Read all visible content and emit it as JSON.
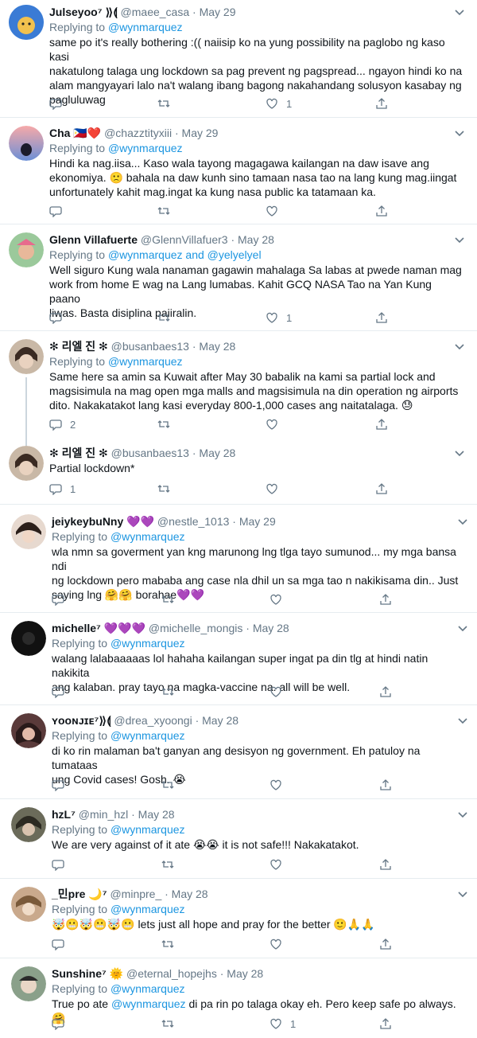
{
  "reply_prefix": "Replying to",
  "tweets": [
    {
      "name": "Julseyoo⁷ ⟫⟬",
      "meta": "@maee_casa · May 29",
      "reply_to": "@wynmarquez",
      "lines": [
        "same po it's really bothering :(( naiisip ko na yung possibility na paglobo ng kaso kasi",
        "nakatulong talaga ung lockdown sa pag prevent ng pagspread... ngayon hindi ko na",
        "alam mangyayari lalo na't walang ibang bagong nakahandang solusyon kasabay ng",
        "pagluluwag"
      ],
      "reply_count": "",
      "like_count": "1"
    },
    {
      "name": "Cha 🇵🇭❤️",
      "meta": "@chazztityxiii · May 29",
      "reply_to": "@wynmarquez",
      "lines": [
        "Hindi ka nag.iisa... Kaso wala tayong magagawa kailangan na daw isave ang",
        "ekonomiya. 🙁 bahala na daw kunh sino tamaan nasa tao na lang kung mag.iingat",
        "unfortunately kahit mag.ingat ka kung nasa public ka tatamaan ka."
      ],
      "reply_count": "",
      "like_count": ""
    },
    {
      "name": "Glenn Villafuerte",
      "meta": "@GlennVillafuer3 · May 28",
      "reply_to": "@wynmarquez and @yelyelyel",
      "lines": [
        "Well siguro Kung wala nanaman gagawin mahalaga Sa labas at pwede naman mag",
        "work from home E wag na Lang lumabas. Kahit GCQ NASA Tao na Yan Kung paano",
        "liwas. Basta disiplina paiiralin."
      ],
      "reply_count": "",
      "like_count": "1"
    },
    {
      "name": "✻ 리엘 진 ✻",
      "meta": "@busanbaes13 · May 28",
      "reply_to": "@wynmarquez",
      "lines": [
        "Same here sa amin sa Kuwait after May 30 babalik na kami sa partial lock and",
        "magsisimula na mag open mga malls and magsisimula na din operation ng airports",
        "dito. Nakakatakot lang kasi everyday 800-1,000 cases ang naitatalaga. 😓"
      ],
      "reply_count": "2",
      "like_count": ""
    },
    {
      "name": "✻ 리엘 진 ✻",
      "meta": "@busanbaes13 · May 28",
      "reply_to": "",
      "lines": [
        "Partial lockdown*"
      ],
      "reply_count": "1",
      "like_count": ""
    },
    {
      "name": "jeiykeybuNny 💜💜",
      "meta": "@nestle_1013 · May 29",
      "reply_to": "@wynmarquez",
      "lines": [
        "wla nmn sa goverment yan kng marunong lng tlga tayo sumunod... my mga bansa ndi",
        "ng lockdown pero mababa ang case nla dhil un sa mga tao n nakikisama din.. Just",
        "saying lng 🤗🤗 borahae💜💜"
      ],
      "reply_count": "",
      "like_count": ""
    },
    {
      "name": "michelle⁷ 💜💜💜",
      "meta": "@michelle_mongis · May 28",
      "reply_to": "@wynmarquez",
      "lines": [
        "walang lalabaaaaas lol hahaha kailangan super ingat pa din tlg at hindi natin nakikita",
        "ang kalaban. pray tayo na magka-vaccine na. all will be well."
      ],
      "reply_count": "",
      "like_count": ""
    },
    {
      "name": "ʏᴏᴏɴᴊɪᴇ⁷⟫⟬",
      "meta": "@drea_xyoongi · May 28",
      "reply_to": "@wynmarquez",
      "lines": [
        "di ko rin malaman ba't ganyan ang desisyon ng government. Eh patuloy na tumataas",
        "ung Covid cases! Gosh. 😭"
      ],
      "reply_count": "",
      "like_count": ""
    },
    {
      "name": "hzL⁷",
      "meta": "@min_hzl · May 28",
      "reply_to": "@wynmarquez",
      "lines": [
        "We are very against of it ate 😭😭 it is not safe!!! Nakakatakot."
      ],
      "reply_count": "",
      "like_count": ""
    },
    {
      "name": "_민pre 🌙⁷",
      "meta": "@minpre_ · May 28",
      "reply_to": "@wynmarquez",
      "lines": [
        "🤯😬🤯😬🤯😬 lets just all hope and pray for the better 🙂🙏🙏"
      ],
      "reply_count": "",
      "like_count": ""
    },
    {
      "name": "Sunshine⁷ 🌞",
      "meta": "@eternal_hopejhs · May 28",
      "reply_to": "@wynmarquez",
      "lines": [],
      "body_prefix": "True po ate ",
      "body_mention": "@wynmarquez",
      "body_suffix": " di pa rin po talaga okay eh. Pero keep safe po always.🤗",
      "reply_count": "",
      "like_count": "1"
    }
  ]
}
